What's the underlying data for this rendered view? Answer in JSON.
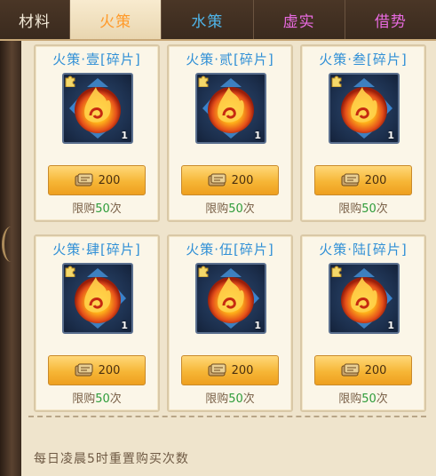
{
  "tabs": [
    {
      "label": "材料"
    },
    {
      "label": "火策"
    },
    {
      "label": "水策"
    },
    {
      "label": "虚实"
    },
    {
      "label": "借势"
    }
  ],
  "active_tab": "火策",
  "colors": {
    "title_blue": "#2f8fd6",
    "limit_green": "#2e9c3a",
    "active_tab_orange": "#ff9a2a"
  },
  "items": [
    {
      "title": "火策·壹[碎片]",
      "qty": "1",
      "price": "200",
      "limit_prefix": "限购",
      "limit_count": "50",
      "limit_suffix": "次",
      "icon": "fire-swirl-icon"
    },
    {
      "title": "火策·贰[碎片]",
      "qty": "1",
      "price": "200",
      "limit_prefix": "限购",
      "limit_count": "50",
      "limit_suffix": "次",
      "icon": "fire-swirl-icon"
    },
    {
      "title": "火策·叁[碎片]",
      "qty": "1",
      "price": "200",
      "limit_prefix": "限购",
      "limit_count": "50",
      "limit_suffix": "次",
      "icon": "fire-swirl-icon"
    },
    {
      "title": "火策·肆[碎片]",
      "qty": "1",
      "price": "200",
      "limit_prefix": "限购",
      "limit_count": "50",
      "limit_suffix": "次",
      "icon": "fire-swirl-icon"
    },
    {
      "title": "火策·伍[碎片]",
      "qty": "1",
      "price": "200",
      "limit_prefix": "限购",
      "limit_count": "50",
      "limit_suffix": "次",
      "icon": "fire-swirl-icon"
    },
    {
      "title": "火策·陆[碎片]",
      "qty": "1",
      "price": "200",
      "limit_prefix": "限购",
      "limit_count": "50",
      "limit_suffix": "次",
      "icon": "fire-swirl-icon"
    }
  ],
  "footer": {
    "note": "每日凌晨5时重置购买次数"
  }
}
